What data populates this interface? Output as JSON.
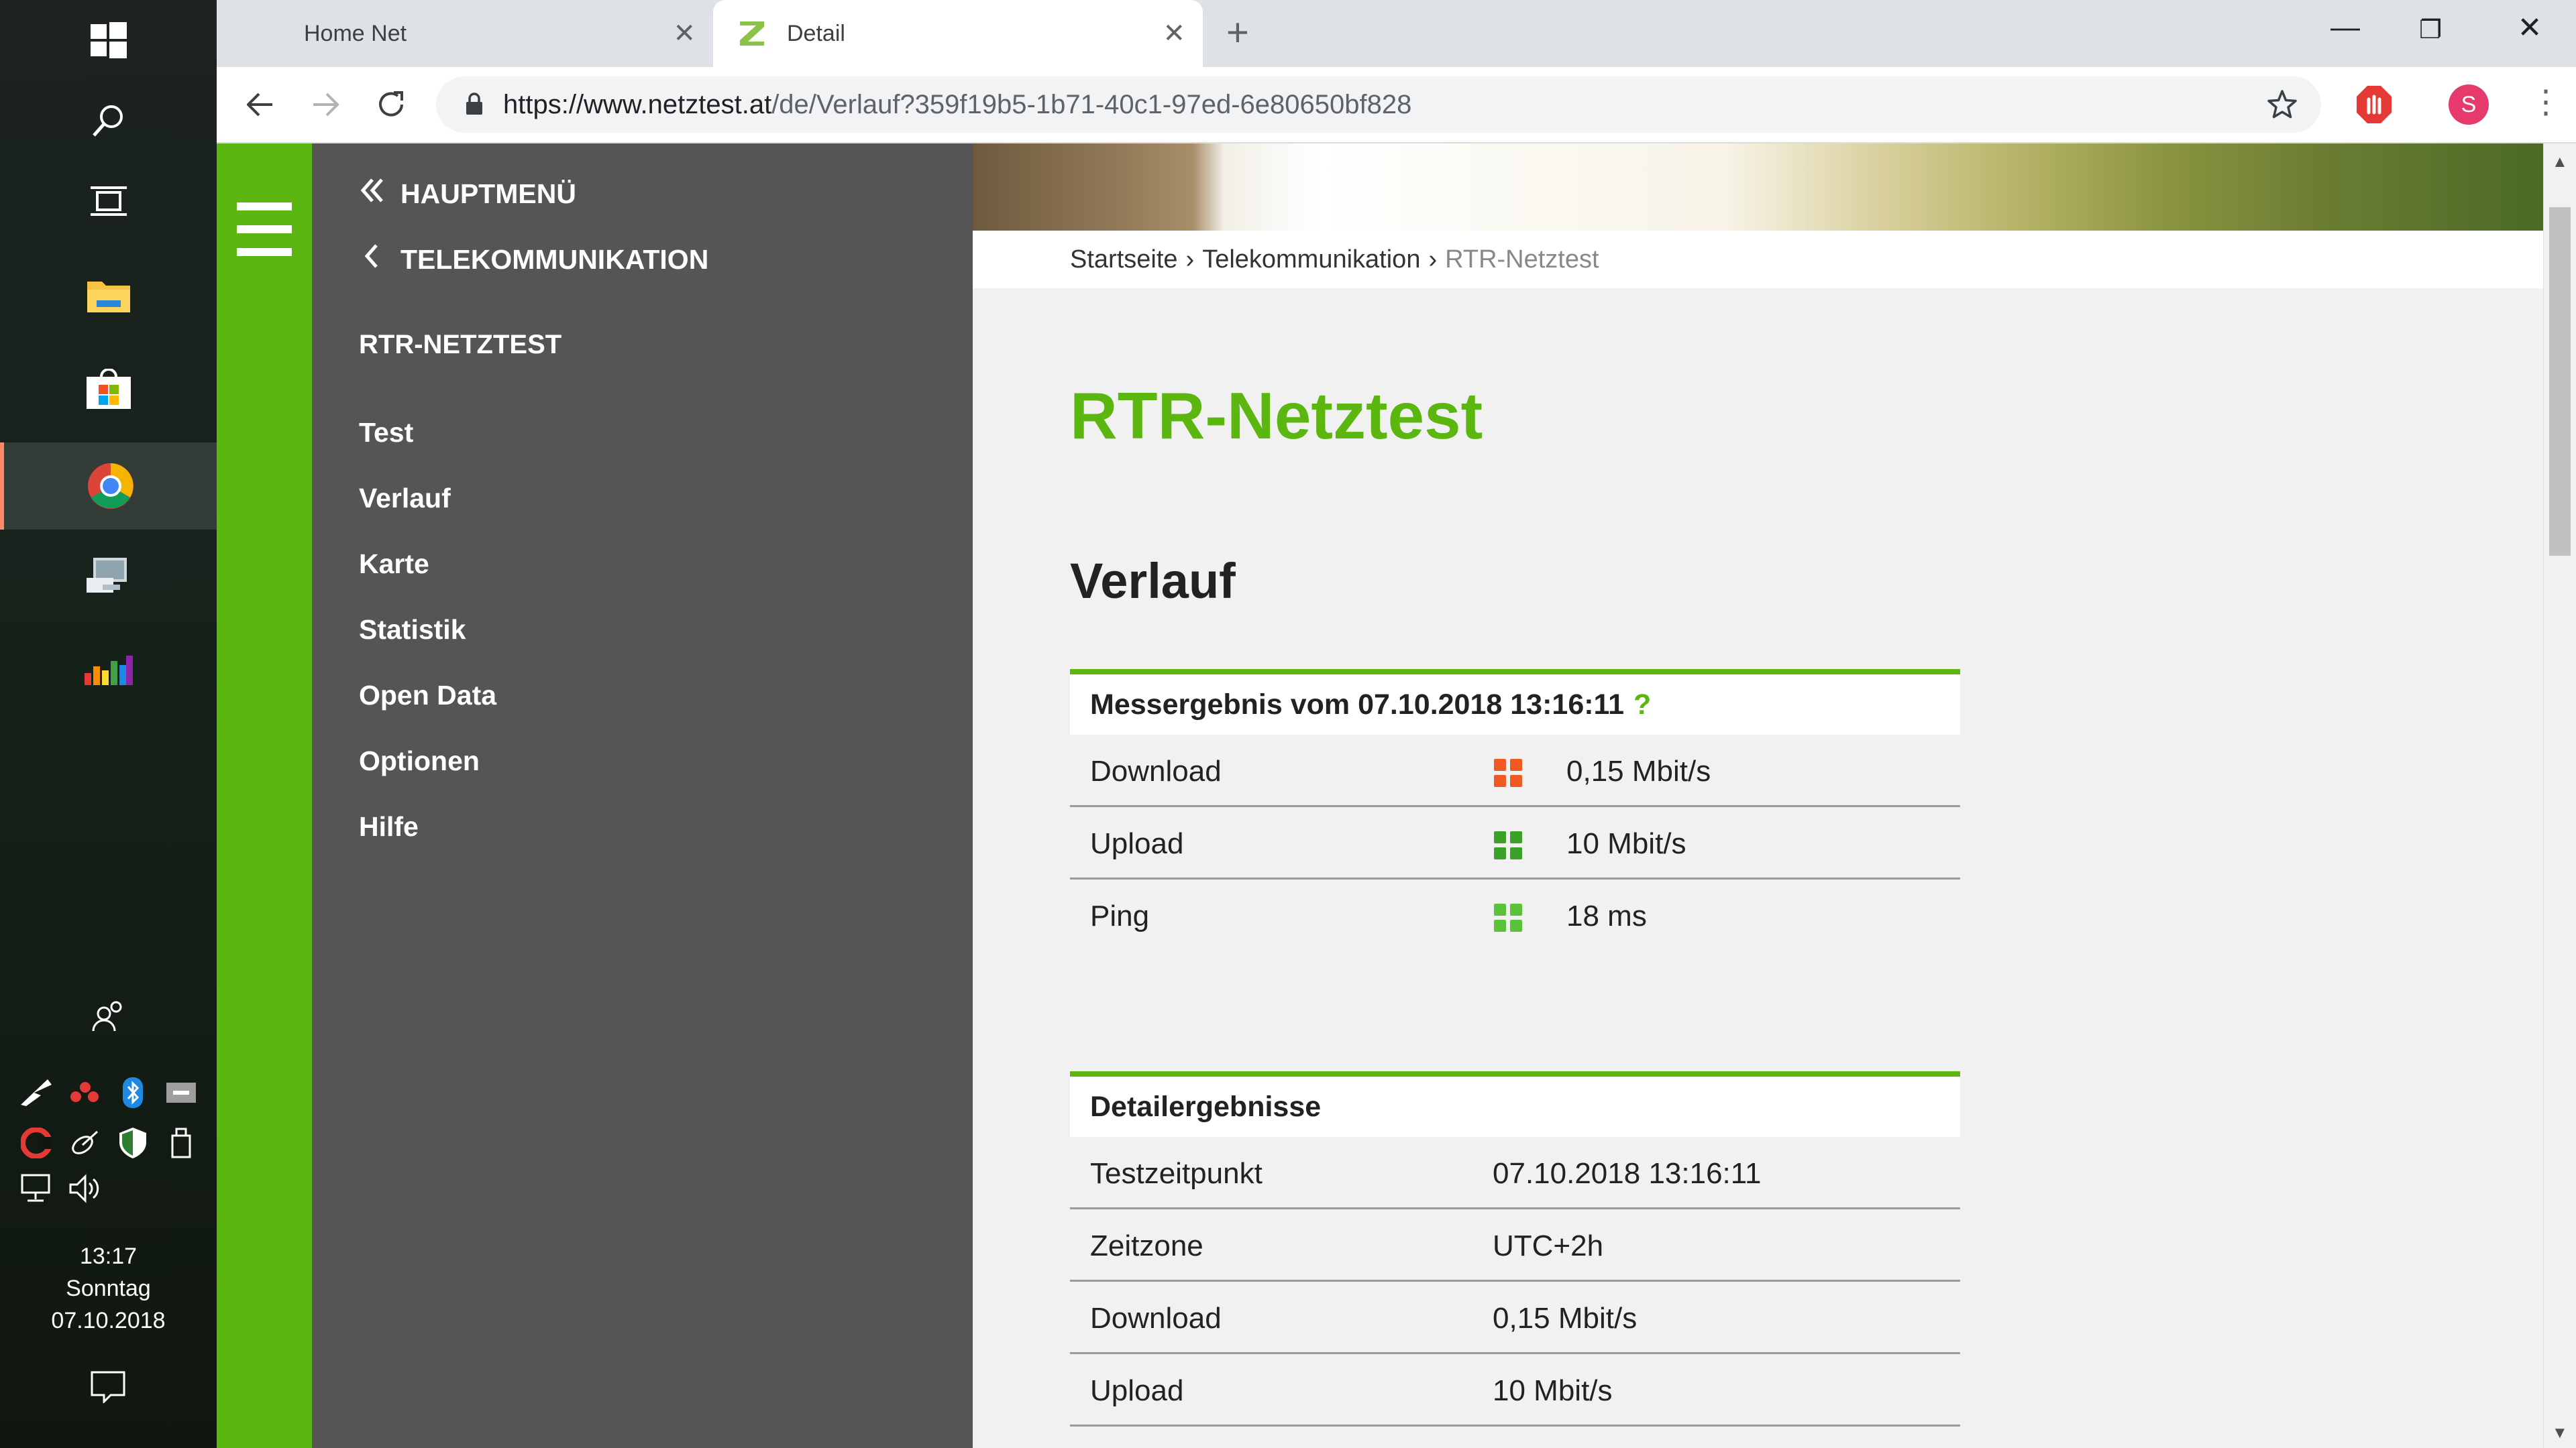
{
  "taskbar": {
    "icons": [
      "windows-start-icon",
      "search-icon",
      "task-view-icon",
      "file-explorer-icon",
      "store-icon",
      "chrome-icon",
      "network-computer-icon",
      "equalizer-app-icon"
    ],
    "tray_icons": [
      "people-icon",
      "aorus-icon",
      "red-app-icon",
      "bluetooth-icon",
      "keyboard-icon",
      "ccleaner-icon",
      "satellite-icon",
      "defender-icon",
      "usb-icon",
      "network-icon",
      "volume-icon"
    ],
    "clock_time": "13:17",
    "clock_day": "Sonntag",
    "clock_date": "07.10.2018"
  },
  "browser": {
    "tabs": [
      {
        "title": "Home Net",
        "active": false
      },
      {
        "title": "Detail",
        "active": true
      }
    ],
    "url_host": "https://www.netztest.at",
    "url_path": "/de/Verlauf?359f19b5-1b71-40c1-97ed-6e80650bf828",
    "profile_initial": "S"
  },
  "sidenav": {
    "back_main": "HAUPTMENÜ",
    "back_telecom": "TELEKOMMUNIKATION",
    "section": "RTR-NETZTEST",
    "items": [
      "Test",
      "Verlauf",
      "Karte",
      "Statistik",
      "Open Data",
      "Optionen",
      "Hilfe"
    ]
  },
  "breadcrumb": {
    "items": [
      "Startseite",
      "Telekommunikation",
      "RTR-Netztest"
    ]
  },
  "page": {
    "title": "RTR-Netztest",
    "section_title": "Verlauf"
  },
  "result": {
    "heading": "Messergebnis vom 07.10.2018 13:16:11",
    "help": "?",
    "rows": [
      {
        "label": "Download",
        "value": "0,15 Mbit/s",
        "rating_color": "#f05a22"
      },
      {
        "label": "Upload",
        "value": "10 Mbit/s",
        "rating_color": "#3aa229"
      },
      {
        "label": "Ping",
        "value": "18 ms",
        "rating_color": "#5ac238"
      }
    ]
  },
  "details": {
    "heading": "Detailergebnisse",
    "rows": [
      {
        "label": "Testzeitpunkt",
        "value": "07.10.2018 13:16:11"
      },
      {
        "label": "Zeitzone",
        "value": "UTC+2h"
      },
      {
        "label": "Download",
        "value": "0,15 Mbit/s"
      },
      {
        "label": "Upload",
        "value": "10 Mbit/s"
      }
    ]
  },
  "colors": {
    "brand_green": "#5cb610",
    "sidenav_gray": "#555555"
  }
}
